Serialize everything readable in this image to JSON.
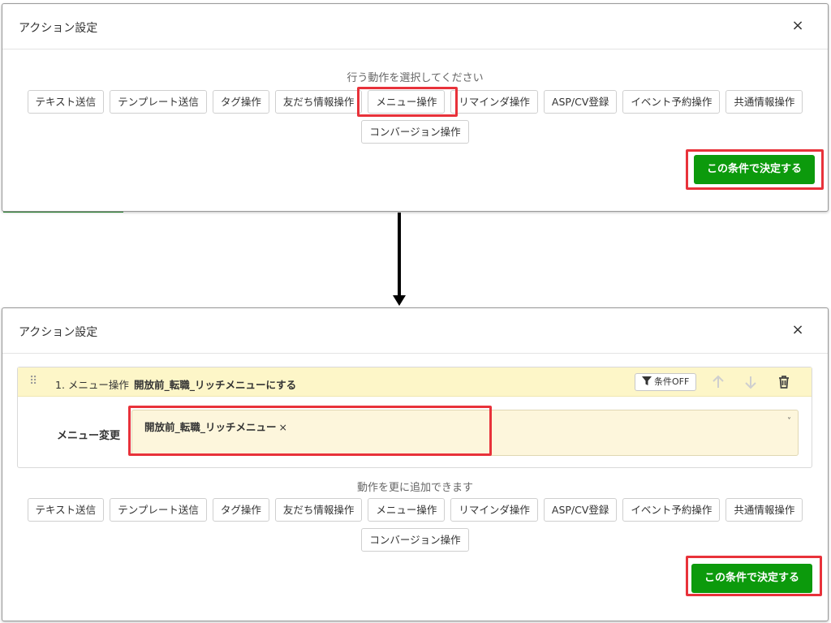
{
  "top_modal": {
    "title": "アクション設定",
    "close_symbol": "×",
    "instruction": "行う動作を選択してください",
    "action_buttons_row1": [
      "テキスト送信",
      "テンプレート送信",
      "タグ操作",
      "友だち情報操作",
      "メニュー操作",
      "リマインダ操作",
      "ASP/CV登録",
      "イベント予約操作",
      "共通情報操作"
    ],
    "action_buttons_row2": [
      "コンバージョン操作"
    ],
    "confirm_label": "この条件で決定する"
  },
  "bottom_modal": {
    "title": "アクション設定",
    "close_symbol": "×",
    "action_card": {
      "drag_symbol": "⠿",
      "number_label": "1. メニュー操作",
      "summary": "開放前_転職_リッチメニューにする",
      "condition_toggle": "条件OFF",
      "field_label": "メニュー変更",
      "selected_value": "開放前_転職_リッチメニュー",
      "remove_symbol": "×",
      "caret_symbol": "˅"
    },
    "instruction": "動作を更に追加できます",
    "action_buttons_row1": [
      "テキスト送信",
      "テンプレート送信",
      "タグ操作",
      "友だち情報操作",
      "メニュー操作",
      "リマインダ操作",
      "ASP/CV登録",
      "イベント予約操作",
      "共通情報操作"
    ],
    "action_buttons_row2": [
      "コンバージョン操作"
    ],
    "confirm_label": "この条件で決定する"
  },
  "icons": {
    "filter": "filter-icon",
    "arrow_up": "arrow-up-icon",
    "arrow_down": "arrow-down-icon",
    "trash": "trash-icon",
    "drag": "drag-handle-icon",
    "flow_arrow": "arrow-down-flow"
  },
  "colors": {
    "accent_green": "#0c9a0c",
    "highlight_red": "#e8323a",
    "card_header_yellow": "#fdf6c8",
    "select_bg": "#fdf6dc"
  }
}
